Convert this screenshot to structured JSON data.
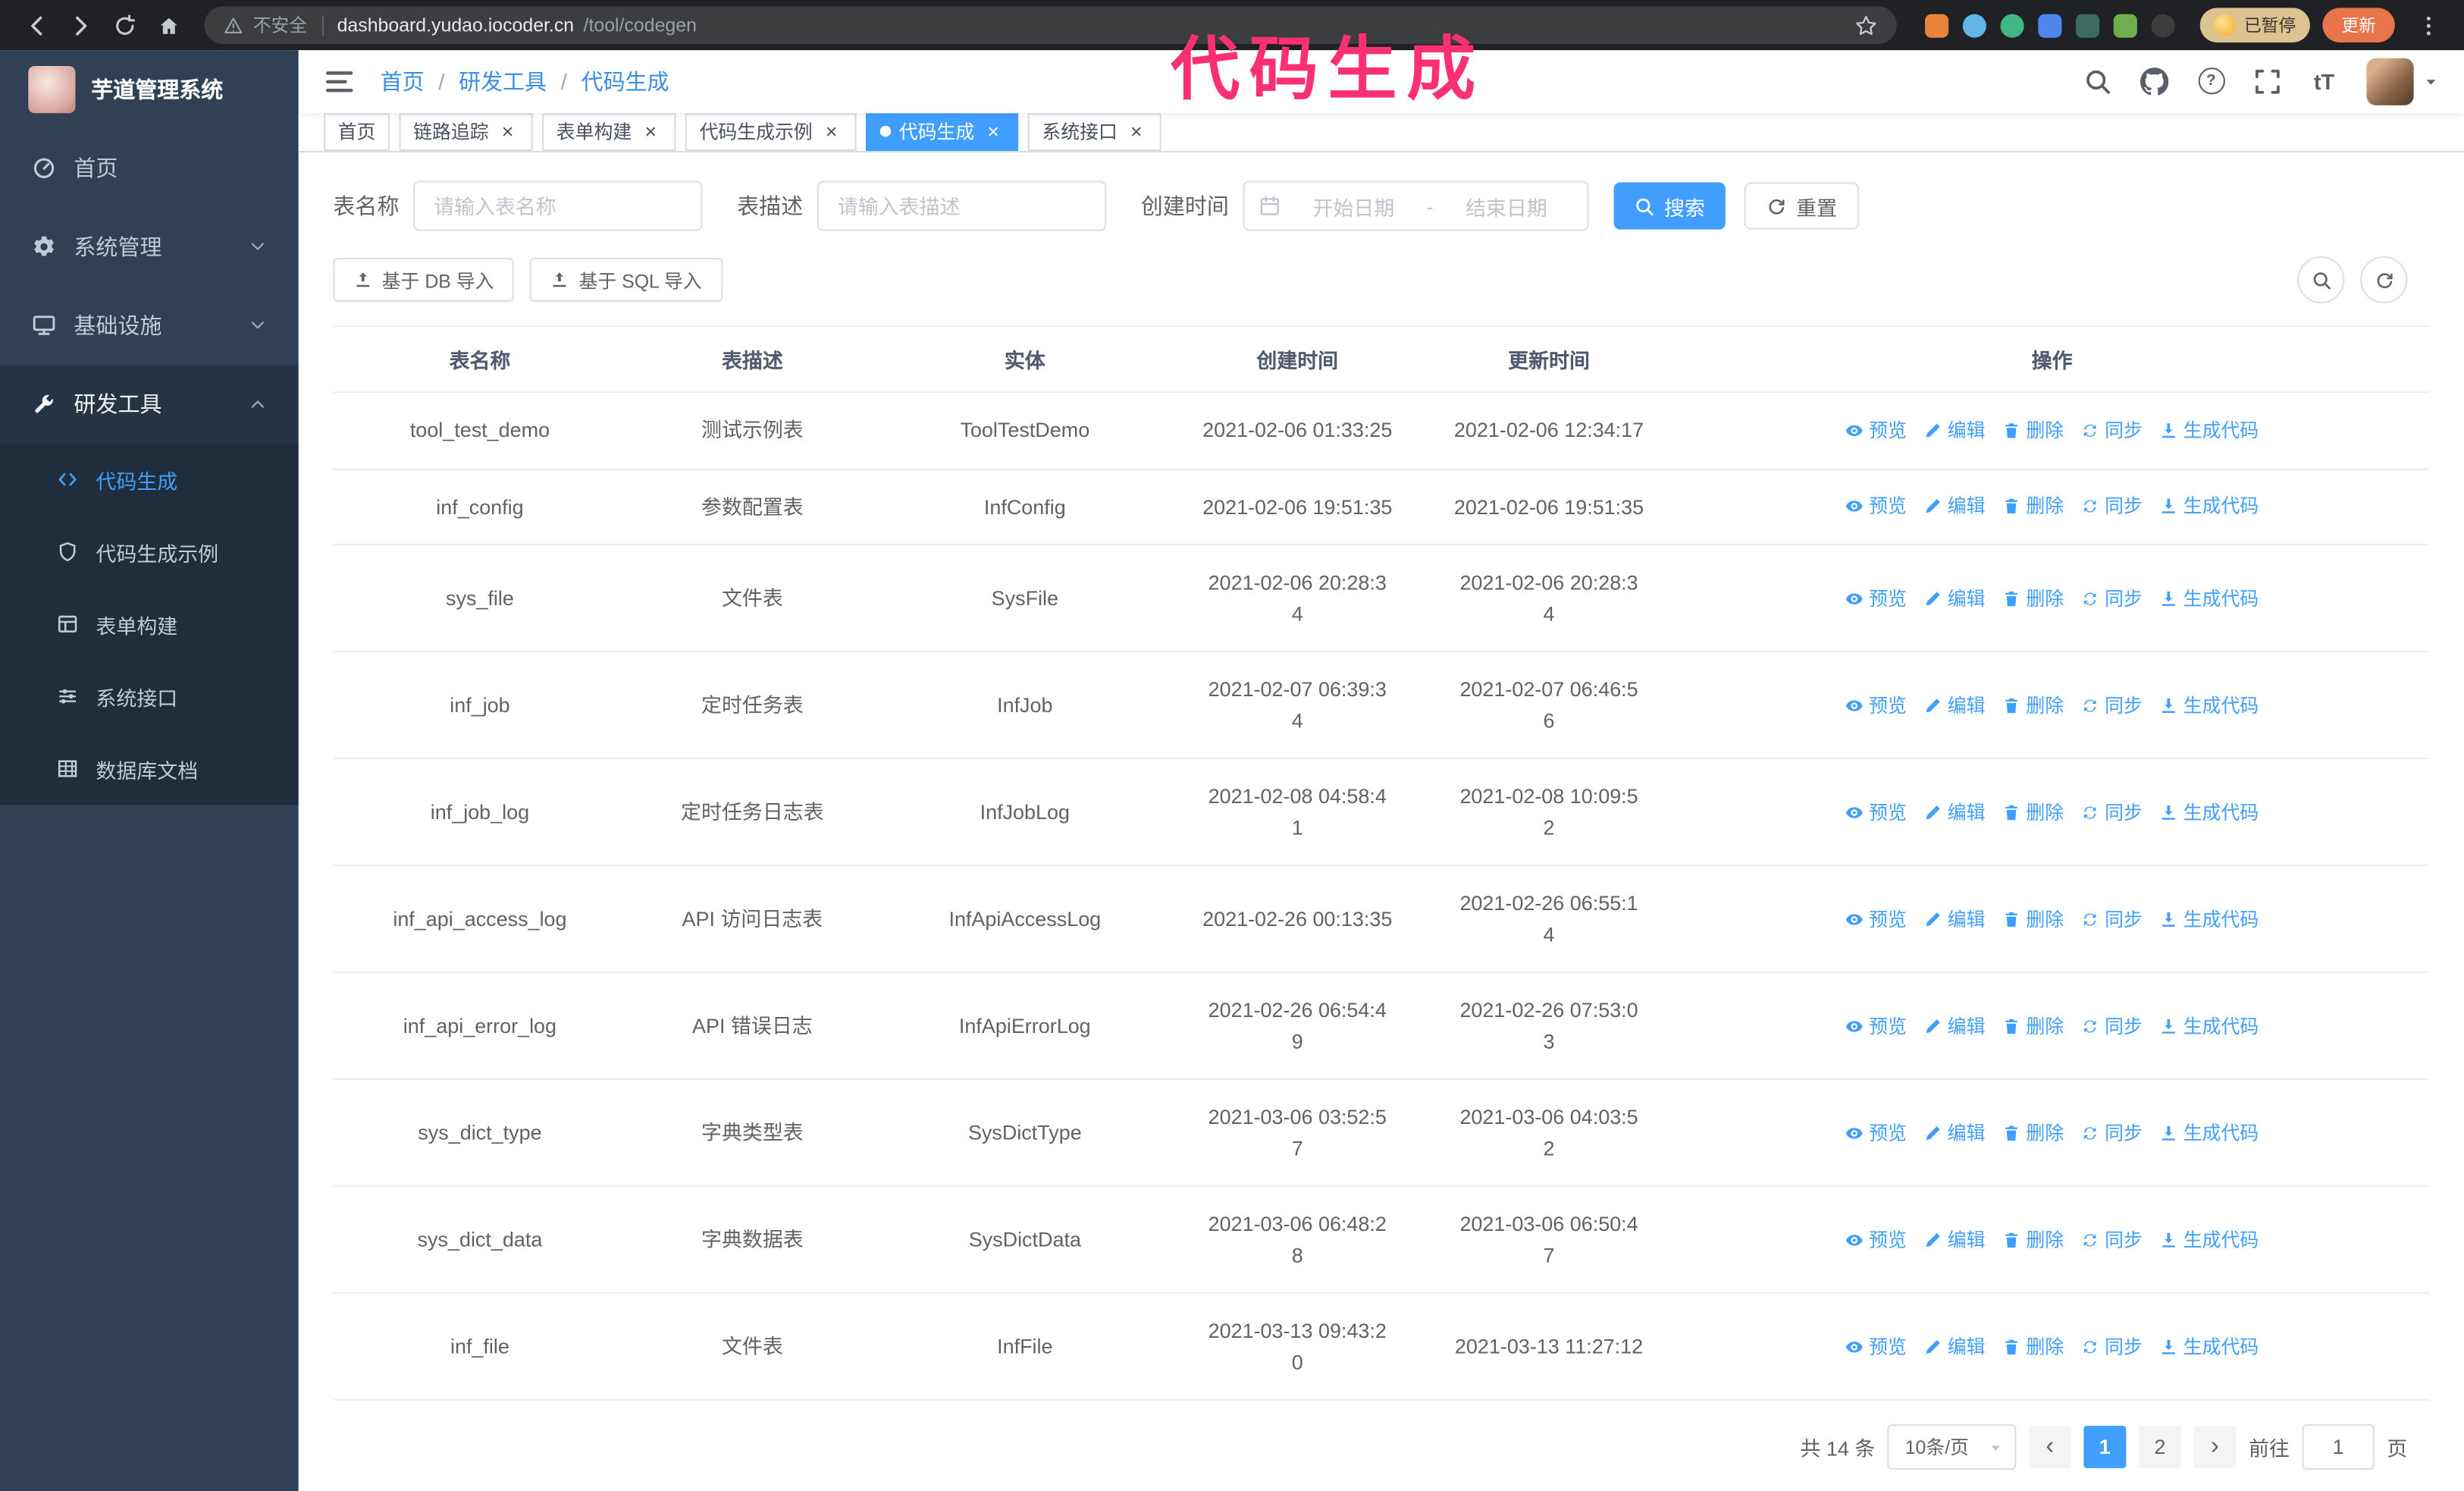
{
  "annotation": {
    "text": "代码生成",
    "color": "#fa2f74"
  },
  "browser": {
    "security_label": "不安全",
    "url_host": "dashboard.yudao.iocoder.cn",
    "url_path": "/tool/codegen",
    "profile_badge": "已暂停",
    "update_button": "更新",
    "extension_colors": [
      "#e8833a",
      "#62b6e7",
      "#41b883",
      "#4f86ec",
      "#3a6b5e",
      "#6fae4e",
      "#3d3d3d"
    ]
  },
  "sidebar": {
    "logo_title": "芋道管理系统",
    "items": [
      {
        "label": "首页",
        "icon": "dashboard-icon"
      },
      {
        "label": "系统管理",
        "icon": "gear-icon"
      },
      {
        "label": "基础设施",
        "icon": "monitor-icon"
      },
      {
        "label": "研发工具",
        "icon": "wrench-icon"
      }
    ],
    "sub_items": [
      {
        "label": "代码生成",
        "icon": "code-icon"
      },
      {
        "label": "代码生成示例",
        "icon": "shield-icon"
      },
      {
        "label": "表单构建",
        "icon": "form-icon"
      },
      {
        "label": "系统接口",
        "icon": "sliders-icon"
      },
      {
        "label": "数据库文档",
        "icon": "grid-icon"
      }
    ]
  },
  "header": {
    "breadcrumb": [
      "首页",
      "研发工具",
      "代码生成"
    ],
    "separator": "/"
  },
  "tabs": [
    {
      "label": "首页"
    },
    {
      "label": "链路追踪"
    },
    {
      "label": "表单构建"
    },
    {
      "label": "代码生成示例"
    },
    {
      "label": "代码生成"
    },
    {
      "label": "系统接口"
    }
  ],
  "filters": {
    "table_name_label": "表名称",
    "table_name_placeholder": "请输入表名称",
    "table_desc_label": "表描述",
    "table_desc_placeholder": "请输入表描述",
    "create_time_label": "创建时间",
    "date_start_placeholder": "开始日期",
    "date_separator": "-",
    "date_end_placeholder": "结束日期",
    "search_button": "搜索",
    "reset_button": "重置"
  },
  "toolbar": {
    "import_db": "基于 DB 导入",
    "import_sql": "基于 SQL 导入"
  },
  "table": {
    "columns": [
      "表名称",
      "表描述",
      "实体",
      "创建时间",
      "更新时间",
      "操作"
    ],
    "actions": [
      {
        "label": "预览",
        "icon": "eye-icon"
      },
      {
        "label": "编辑",
        "icon": "edit-icon"
      },
      {
        "label": "删除",
        "icon": "trash-icon"
      },
      {
        "label": "同步",
        "icon": "sync-icon"
      },
      {
        "label": "生成代码",
        "icon": "download-icon"
      }
    ],
    "rows": [
      {
        "name": "tool_test_demo",
        "desc": "测试示例表",
        "entity": "ToolTestDemo",
        "created": "2021-02-06 01:33:25",
        "updated": "2021-02-06 12:34:17"
      },
      {
        "name": "inf_config",
        "desc": "参数配置表",
        "entity": "InfConfig",
        "created": "2021-02-06 19:51:35",
        "updated": "2021-02-06 19:51:35"
      },
      {
        "name": "sys_file",
        "desc": "文件表",
        "entity": "SysFile",
        "created": "2021-02-06 20:28:3\n4",
        "updated": "2021-02-06 20:28:3\n4"
      },
      {
        "name": "inf_job",
        "desc": "定时任务表",
        "entity": "InfJob",
        "created": "2021-02-07 06:39:3\n4",
        "updated": "2021-02-07 06:46:5\n6"
      },
      {
        "name": "inf_job_log",
        "desc": "定时任务日志表",
        "entity": "InfJobLog",
        "created": "2021-02-08 04:58:4\n1",
        "updated": "2021-02-08 10:09:5\n2"
      },
      {
        "name": "inf_api_access_log",
        "desc": "API 访问日志表",
        "entity": "InfApiAccessLog",
        "created": "2021-02-26 00:13:35",
        "updated": "2021-02-26 06:55:1\n4"
      },
      {
        "name": "inf_api_error_log",
        "desc": "API 错误日志",
        "entity": "InfApiErrorLog",
        "created": "2021-02-26 06:54:4\n9",
        "updated": "2021-02-26 07:53:0\n3"
      },
      {
        "name": "sys_dict_type",
        "desc": "字典类型表",
        "entity": "SysDictType",
        "created": "2021-03-06 03:52:5\n7",
        "updated": "2021-03-06 04:03:5\n2"
      },
      {
        "name": "sys_dict_data",
        "desc": "字典数据表",
        "entity": "SysDictData",
        "created": "2021-03-06 06:48:2\n8",
        "updated": "2021-03-06 06:50:4\n7"
      },
      {
        "name": "inf_file",
        "desc": "文件表",
        "entity": "InfFile",
        "created": "2021-03-13 09:43:2\n0",
        "updated": "2021-03-13 11:27:12"
      }
    ]
  },
  "pagination": {
    "total": "共 14 条",
    "page_size": "10条/页",
    "pages": [
      "1",
      "2"
    ],
    "current": "1",
    "goto_label": "前往",
    "goto_value": "1",
    "goto_suffix": "页"
  },
  "colors": {
    "primary": "#409eff",
    "sidebar_bg": "#304156",
    "submenu_bg": "#1f2d3d"
  }
}
